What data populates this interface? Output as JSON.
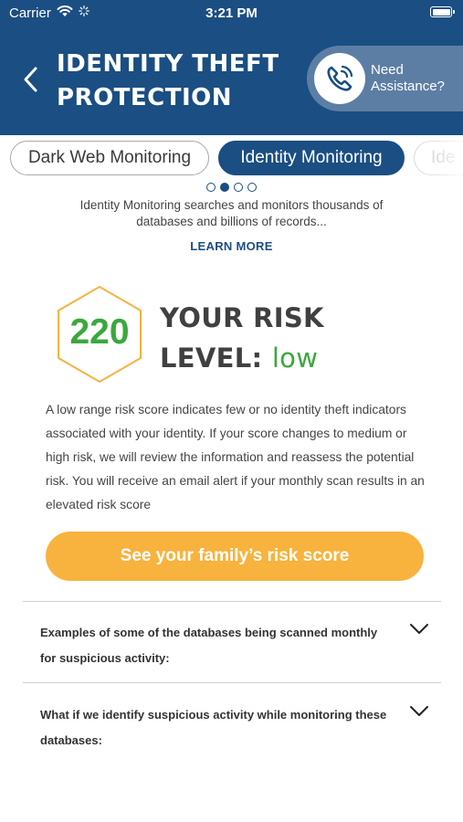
{
  "status_bar": {
    "carrier": "Carrier",
    "time": "3:21 PM"
  },
  "header": {
    "title": "IDENTITY THEFT PROTECTION",
    "assistance_line1": "Need",
    "assistance_line2": "Assistance?",
    "color": "#1b4e82"
  },
  "tabs": [
    {
      "label": "Dark Web Monitoring",
      "selected": false
    },
    {
      "label": "Identity Monitoring",
      "selected": true
    },
    {
      "label": "Ide",
      "selected": false
    }
  ],
  "pager": {
    "count": 4,
    "active_index": 1
  },
  "intro": {
    "text": "Identity Monitoring searches and monitors thousands of databases and billions of records...",
    "learn_more": "LEARN MORE"
  },
  "risk": {
    "score": "220",
    "heading_line1": "YOUR RISK",
    "heading_line2": "LEVEL: ",
    "level": "low",
    "level_color": "#3aa83d",
    "hex_color": "#f8b23e",
    "description": "A low range risk score indicates few or no identity theft indicators associated with your identity. If your score changes to medium or high risk, we will review the information and reassess the potential risk. You will receive an email alert if your monthly scan results in an elevated risk score"
  },
  "family_button": {
    "label": "See your family’s risk score",
    "color": "#f8b23e"
  },
  "faq": [
    {
      "question": "Examples of some of the databases being scanned monthly for suspicious activity:",
      "icon": "chevron-down-icon"
    },
    {
      "question": "What if we identify suspicious activity while monitoring these databases:",
      "icon": "chevron-down-icon"
    }
  ]
}
